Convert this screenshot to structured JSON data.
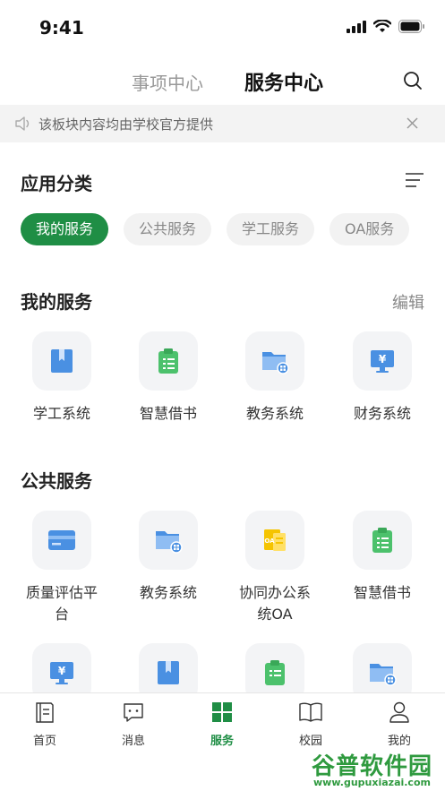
{
  "status_bar": {
    "time": "9:41"
  },
  "header": {
    "tabs": [
      {
        "label": "事项中心"
      },
      {
        "label": "服务中心"
      }
    ]
  },
  "notice": {
    "text": "该板块内容均由学校官方提供"
  },
  "categories": {
    "title": "应用分类",
    "chips": [
      {
        "label": "我的服务"
      },
      {
        "label": "公共服务"
      },
      {
        "label": "学工服务"
      },
      {
        "label": "OA服务"
      }
    ]
  },
  "my_services": {
    "title": "我的服务",
    "edit_label": "编辑",
    "items": [
      {
        "label": "学工系统",
        "icon": "bookmark-icon"
      },
      {
        "label": "智慧借书",
        "icon": "clipboard-icon"
      },
      {
        "label": "教务系统",
        "icon": "folder-icon"
      },
      {
        "label": "财务系统",
        "icon": "monitor-yen-icon"
      }
    ]
  },
  "public_services": {
    "title": "公共服务",
    "items": [
      {
        "label": "质量评估平台",
        "icon": "card-icon"
      },
      {
        "label": "教务系统",
        "icon": "folder-icon"
      },
      {
        "label": "协同办公系统OA",
        "icon": "oa-doc-icon"
      },
      {
        "label": "智慧借书",
        "icon": "clipboard-icon"
      }
    ],
    "partial_items": [
      {
        "icon": "monitor-yen-icon"
      },
      {
        "icon": "bookmark-icon"
      },
      {
        "icon": "clipboard-icon"
      },
      {
        "icon": "folder-icon"
      }
    ]
  },
  "tab_bar": {
    "items": [
      {
        "label": "首页"
      },
      {
        "label": "消息"
      },
      {
        "label": "服务"
      },
      {
        "label": "校园"
      },
      {
        "label": "我的"
      }
    ]
  },
  "watermark": {
    "title": "谷普软件园",
    "url": "www.gupuxiazai.com"
  },
  "colors": {
    "accent": "#1f8e45",
    "blue": "#4a90e2",
    "green": "#4cc16c",
    "yellow": "#f5c400"
  }
}
